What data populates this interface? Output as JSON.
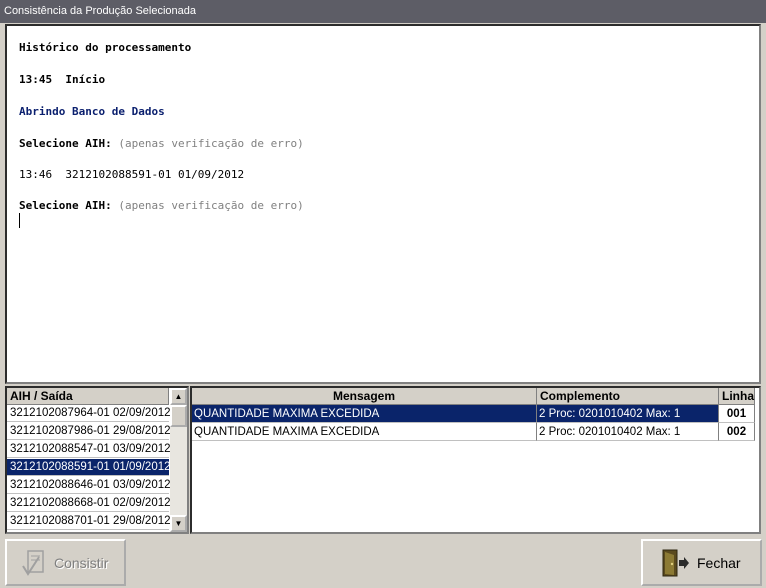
{
  "window": {
    "title": "Consistência da Produção Selecionada"
  },
  "log": {
    "heading": "Histórico do processamento",
    "start_line": "13:45  Início",
    "opening_db": "Abrindo Banco de Dados",
    "select_label": "Selecione AIH:",
    "select_hint": "(apenas verificação de erro)",
    "entry_line": "13:46  3212102088591-01 01/09/2012",
    "select_label_2": "Selecione AIH:",
    "select_hint_2": "(apenas verificação de erro)"
  },
  "aih_list": {
    "header": "AIH / Saída",
    "items": [
      "3212102087964-01 02/09/2012",
      "3212102087986-01 29/08/2012",
      "3212102088547-01 03/09/2012",
      "3212102088591-01 01/09/2012",
      "3212102088646-01 03/09/2012",
      "3212102088668-01 02/09/2012",
      "3212102088701-01 29/08/2012"
    ],
    "selected_index": 3
  },
  "messages_grid": {
    "columns": [
      "Mensagem",
      "Complemento",
      "Linha"
    ],
    "rows": [
      {
        "mensagem": "QUANTIDADE MAXIMA EXCEDIDA",
        "complemento": "2  Proc: 0201010402  Max: 1",
        "linha": "001"
      },
      {
        "mensagem": "QUANTIDADE MAXIMA EXCEDIDA",
        "complemento": "2  Proc: 0201010402  Max: 1",
        "linha": "002"
      }
    ]
  },
  "buttons": {
    "consistir": "Consistir",
    "fechar": "Fechar"
  },
  "icons": {
    "consistir": "checklist-icon",
    "fechar": "exit-door-icon"
  }
}
